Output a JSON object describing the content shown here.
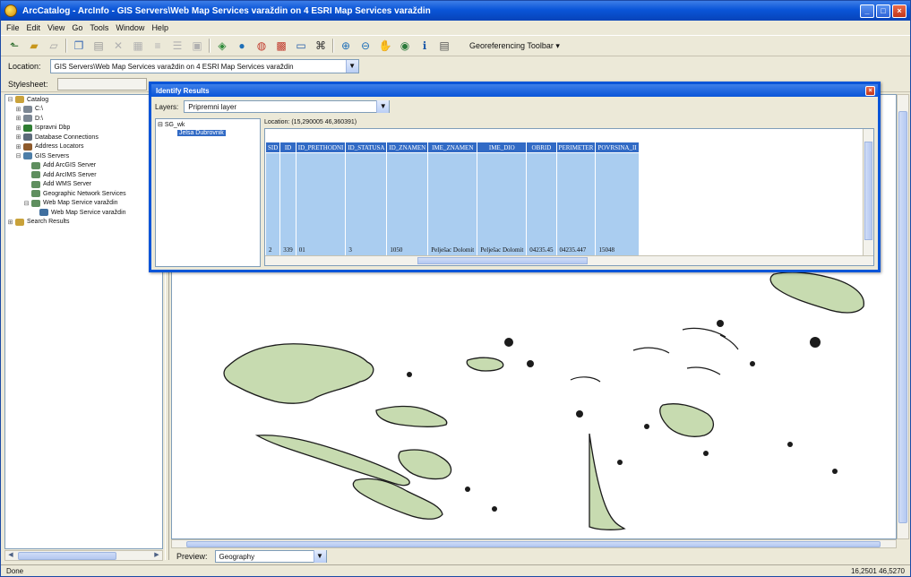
{
  "window": {
    "title": "ArcCatalog - ArcInfo - GIS Servers\\Web Map Services varaždin on 4 ESRI Map Services varaždin",
    "buttons": {
      "minimize": "_",
      "maximize": "□",
      "close": "×"
    }
  },
  "menu": [
    "File",
    "Edit",
    "View",
    "Go",
    "Tools",
    "Window",
    "Help"
  ],
  "toolbar": {
    "icons": [
      "up-one-level-icon",
      "connect-folder-icon",
      "disconnect-folder-icon",
      "copy-icon",
      "paste-icon",
      "delete-icon",
      "large-icons-icon",
      "list-icon",
      "details-icon",
      "thumbnails-icon",
      "launch-arcmap-icon",
      "catalog-tree-icon",
      "search-icon",
      "arctoolbox-icon",
      "python-icon",
      "model-builder-icon",
      "zoom-in-icon",
      "zoom-out-icon",
      "pan-icon",
      "full-extent-icon",
      "identify-icon",
      "create-thumbnail-icon"
    ],
    "dropdown_label": "Georeferencing Toolbar"
  },
  "location": {
    "label": "Location:",
    "value": "GIS Servers\\Web Map Services varaždin on 4 ESRI Map Services varaždin"
  },
  "stylesheet": {
    "label": "Stylesheet:"
  },
  "catalog": {
    "items": [
      {
        "label": "Catalog",
        "indent": 0,
        "pm": "-",
        "color": "#c9a23a"
      },
      {
        "label": "C:\\",
        "indent": 1,
        "pm": "+",
        "color": "#7c8794"
      },
      {
        "label": "D:\\",
        "indent": 1,
        "pm": "+",
        "color": "#7c8794"
      },
      {
        "label": "Ispravni Dbp",
        "indent": 1,
        "pm": "+",
        "color": "#2e7d32"
      },
      {
        "label": "Database Connections",
        "indent": 1,
        "pm": "+",
        "color": "#5d6b7a"
      },
      {
        "label": "Address Locators",
        "indent": 1,
        "pm": "+",
        "color": "#8e5a2b"
      },
      {
        "label": "GIS Servers",
        "indent": 1,
        "pm": "-",
        "color": "#4d7ea8"
      },
      {
        "label": "Add ArcGIS Server",
        "indent": 2,
        "pm": "",
        "color": "#5f8f5f"
      },
      {
        "label": "Add ArcIMS Server",
        "indent": 2,
        "pm": "",
        "color": "#5f8f5f"
      },
      {
        "label": "Add WMS Server",
        "indent": 2,
        "pm": "",
        "color": "#5f8f5f"
      },
      {
        "label": "Geographic Network Services",
        "indent": 2,
        "pm": "",
        "color": "#5f8f5f"
      },
      {
        "label": "Web Map Service varaždin",
        "indent": 2,
        "pm": "-",
        "color": "#5f8f5f"
      },
      {
        "label": "Web Map Service varaždin",
        "indent": 3,
        "pm": "",
        "color": "#3f6f9f"
      },
      {
        "label": "Search Results",
        "indent": 0,
        "pm": "+",
        "color": "#c9a23a"
      }
    ]
  },
  "identify": {
    "title": "Identify Results",
    "layers_label": "Layers:",
    "layers_value": "Pripremni layer",
    "tree_root": "SG_wk",
    "tree_selected": "Jelsa Dubrovnik",
    "location": "Location: (15,290005 46,360391)",
    "table": {
      "headers": [
        "SID",
        "ID",
        "ID_PRETHODNI",
        "ID_STATUSA",
        "ID_ZNAMEN",
        "IME_ZNAMEN",
        "IME_DIO",
        "OBRID",
        "PERIMETER",
        "POVRSINA_II"
      ],
      "rows": [
        [
          "2",
          "339",
          "01",
          "3",
          "1050",
          "Pelješac Dolomit",
          "Pelješac Dolomit",
          "04235.45",
          "04235.447",
          "15048"
        ]
      ]
    }
  },
  "preview": {
    "label": "Preview:",
    "value": "Geography"
  },
  "status": {
    "left": "Done",
    "right": "16,2501 46,5270"
  }
}
